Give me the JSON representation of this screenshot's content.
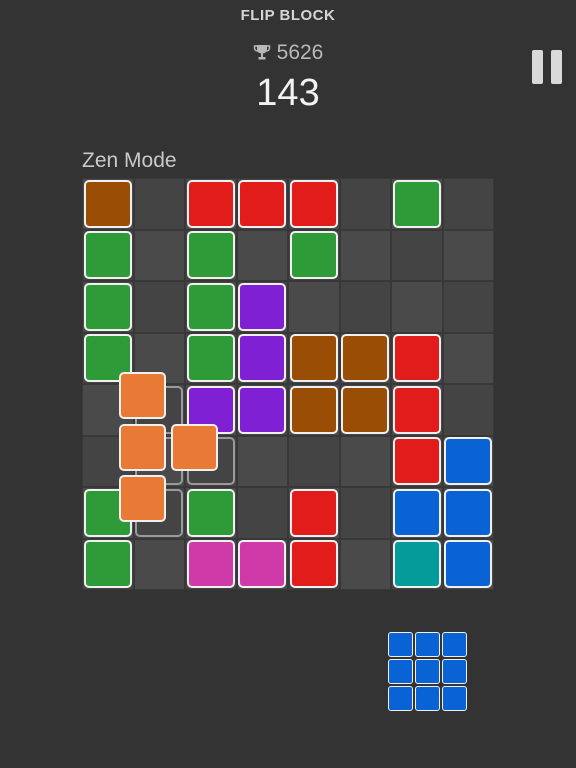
{
  "header": {
    "title": "FLIP BLOCK",
    "best_score": "5626",
    "score": "143",
    "mode": "Zen Mode"
  },
  "icons": {
    "best": "trophy-icon",
    "pause": "pause-icon"
  },
  "colors": {
    "background": "#333333",
    "brown": "#9a4e05",
    "red": "#e21b1b",
    "green": "#2e9a38",
    "purple": "#8020d4",
    "orange": "#e97a35",
    "blue": "#0a63d4",
    "magenta": "#d03aa8",
    "teal": "#069b9b",
    "tile_border": "#f0f0f0"
  },
  "board": {
    "size": 8,
    "cells": [
      [
        "brown",
        null,
        "red",
        "red",
        "red",
        null,
        "green",
        null
      ],
      [
        "green",
        null,
        "green",
        null,
        "green",
        null,
        null,
        null
      ],
      [
        "green",
        null,
        "green",
        "purple",
        null,
        null,
        null,
        null
      ],
      [
        "green",
        null,
        "green",
        "purple",
        "brown",
        "brown",
        "red",
        null
      ],
      [
        null,
        null,
        "purple",
        "purple",
        "brown",
        "brown",
        "red",
        null
      ],
      [
        null,
        null,
        null,
        null,
        null,
        null,
        "red",
        "blue"
      ],
      [
        "green",
        null,
        "green",
        null,
        "red",
        null,
        "blue",
        "blue"
      ],
      [
        "green",
        null,
        "magenta",
        "magenta",
        "red",
        null,
        "teal",
        "blue"
      ]
    ],
    "ghost_outline": [
      [
        4,
        1
      ],
      [
        5,
        1
      ],
      [
        5,
        2
      ],
      [
        6,
        1
      ]
    ]
  },
  "active_piece": {
    "color": "orange",
    "tiles": [
      [
        0,
        0
      ],
      [
        1,
        0
      ],
      [
        1,
        1
      ],
      [
        2,
        0
      ]
    ]
  },
  "next_piece": {
    "color": "blue",
    "tiles": [
      [
        0,
        0
      ],
      [
        0,
        1
      ],
      [
        0,
        2
      ],
      [
        1,
        0
      ],
      [
        1,
        1
      ],
      [
        1,
        2
      ],
      [
        2,
        0
      ],
      [
        2,
        1
      ],
      [
        2,
        2
      ]
    ]
  }
}
